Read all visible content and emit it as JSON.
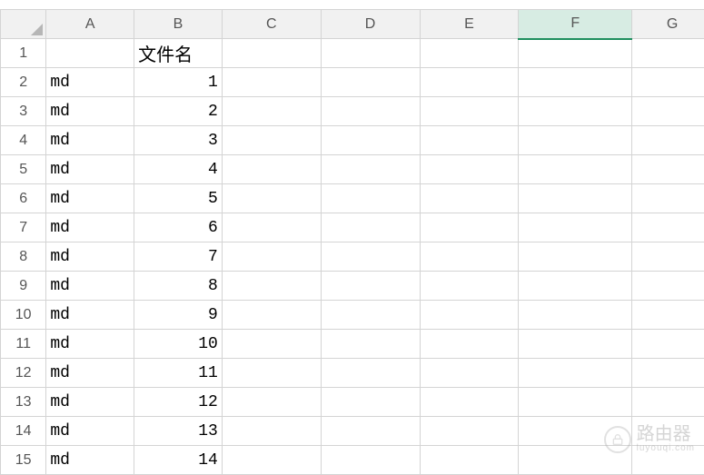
{
  "columns": [
    "A",
    "B",
    "C",
    "D",
    "E",
    "F",
    "G"
  ],
  "selectedColumn": "F",
  "rows": [
    {
      "n": 1,
      "A": "",
      "B": "文件名"
    },
    {
      "n": 2,
      "A": "md",
      "B": 1
    },
    {
      "n": 3,
      "A": "md",
      "B": 2
    },
    {
      "n": 4,
      "A": "md",
      "B": 3
    },
    {
      "n": 5,
      "A": "md",
      "B": 4
    },
    {
      "n": 6,
      "A": "md",
      "B": 5
    },
    {
      "n": 7,
      "A": "md",
      "B": 6
    },
    {
      "n": 8,
      "A": "md",
      "B": 7
    },
    {
      "n": 9,
      "A": "md",
      "B": 8
    },
    {
      "n": 10,
      "A": "md",
      "B": 9
    },
    {
      "n": 11,
      "A": "md",
      "B": 10
    },
    {
      "n": 12,
      "A": "md",
      "B": 11
    },
    {
      "n": 13,
      "A": "md",
      "B": 12
    },
    {
      "n": 14,
      "A": "md",
      "B": 13
    },
    {
      "n": 15,
      "A": "md",
      "B": 14
    }
  ],
  "watermark": {
    "title": "路由器",
    "sub": "luyouqi.com"
  },
  "chart_data": {
    "type": "table",
    "columns": [
      "A",
      "B"
    ],
    "header_row": {
      "A": "",
      "B": "文件名"
    },
    "data": [
      {
        "A": "md",
        "B": 1
      },
      {
        "A": "md",
        "B": 2
      },
      {
        "A": "md",
        "B": 3
      },
      {
        "A": "md",
        "B": 4
      },
      {
        "A": "md",
        "B": 5
      },
      {
        "A": "md",
        "B": 6
      },
      {
        "A": "md",
        "B": 7
      },
      {
        "A": "md",
        "B": 8
      },
      {
        "A": "md",
        "B": 9
      },
      {
        "A": "md",
        "B": 10
      },
      {
        "A": "md",
        "B": 11
      },
      {
        "A": "md",
        "B": 12
      },
      {
        "A": "md",
        "B": 13
      },
      {
        "A": "md",
        "B": 14
      }
    ]
  }
}
